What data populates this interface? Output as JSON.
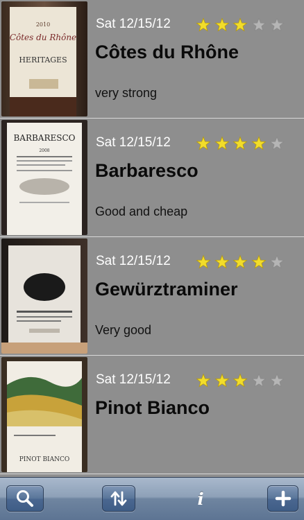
{
  "wines": [
    {
      "date": "Sat 12/15/12",
      "name": "Côtes du Rhône",
      "note": "very strong",
      "rating": 3,
      "label": {
        "line1": "2010",
        "line2": "Côtes du Rhône",
        "line3": "HERITAGES"
      }
    },
    {
      "date": "Sat 12/15/12",
      "name": "Barbaresco",
      "note": "Good and cheap",
      "rating": 4,
      "label": {
        "line1": "BARBARESCO",
        "line2": "2008"
      }
    },
    {
      "date": "Sat 12/15/12",
      "name": "Gewürztraminer",
      "note": "Very good",
      "rating": 4,
      "label": {}
    },
    {
      "date": "Sat 12/15/12",
      "name": "Pinot Bianco",
      "note": "",
      "rating": 3,
      "label": {
        "line1": "PINOT BIANCO"
      }
    }
  ],
  "toolbar": {
    "search_icon": "search-icon",
    "sort_icon": "sort-arrows-icon",
    "info_label": "i",
    "add_icon": "plus-icon"
  },
  "colors": {
    "star_filled": "#f2dd2a",
    "star_empty": "#b5b5b5",
    "toolbar": "#6f85a0"
  }
}
